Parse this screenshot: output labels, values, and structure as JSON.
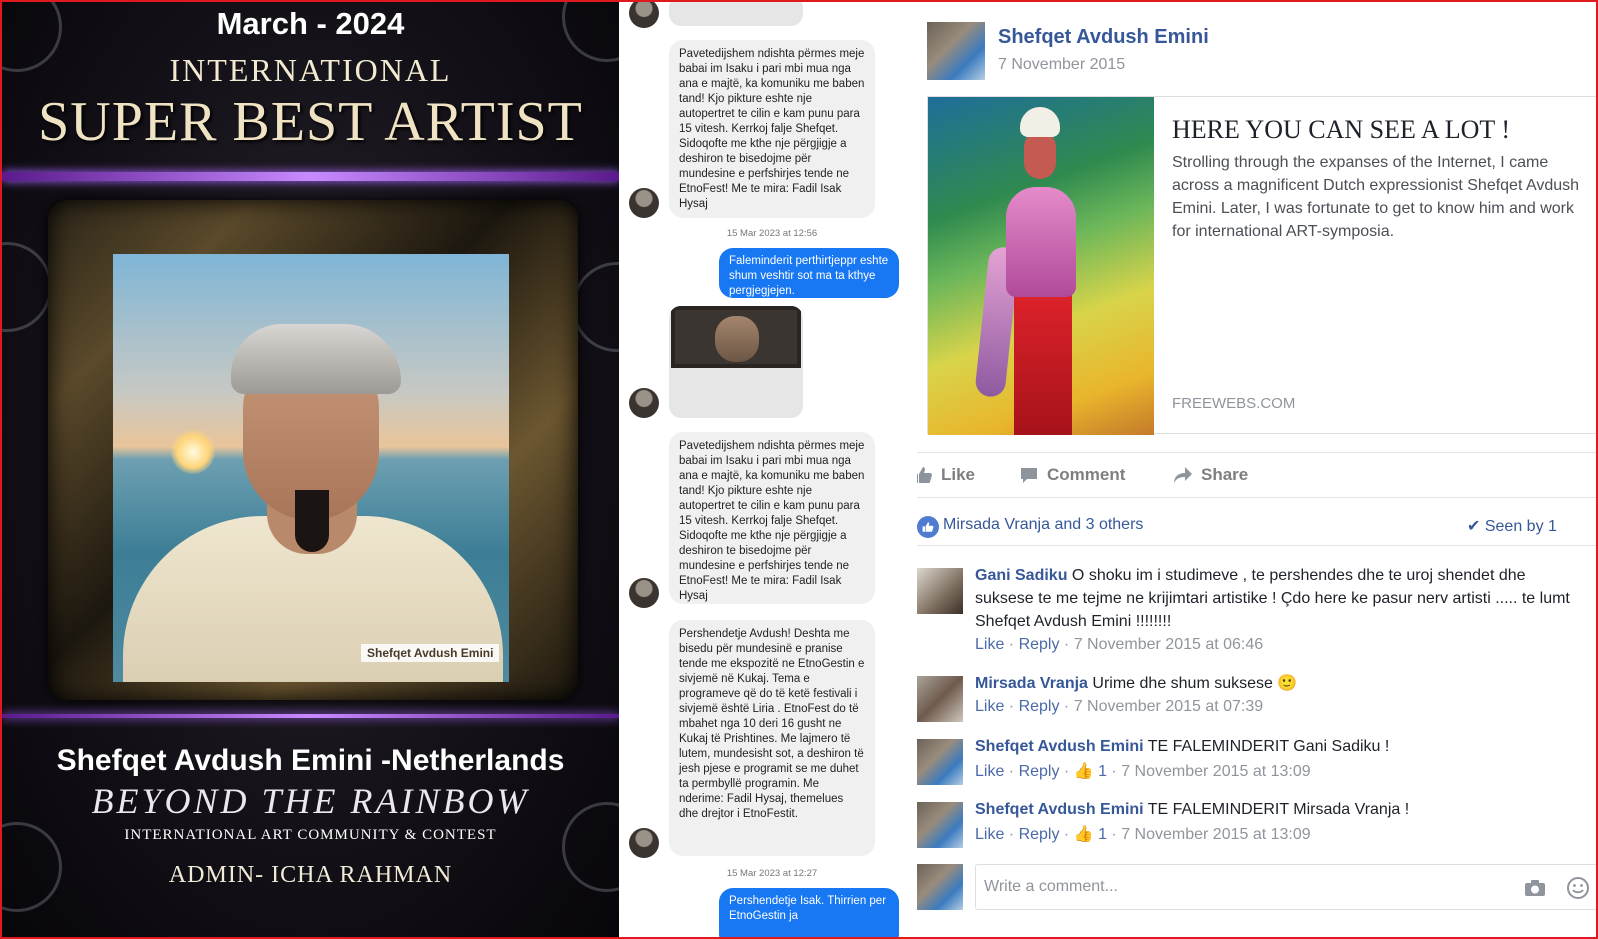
{
  "poster": {
    "date": "March - 2024",
    "subtitle": "INTERNATIONAL",
    "title": "SUPER BEST ARTIST",
    "photo_caption": "Shefqet Avdush Emini",
    "name": "Shefqet Avdush Emini -Netherlands",
    "tagline": "BEYOND THE RAINBOW",
    "community": "INTERNATIONAL ART COMMUNITY & CONTEST",
    "admin": "ADMIN- ICHA RAHMAN"
  },
  "chat": {
    "msg1": "Pavetedijshem ndishta përmes meje babai im Isaku i pari mbi mua nga ana e majtë, ka komuniku me baben tand! Kjo pikture eshte nje autopertret te cilin e kam punu para 15 vitesh. Kerrkoj falje Shefqet. Sidoqofte me kthe nje përgjigje a deshiron te bisedojme për mundesine e perfshirjes tende ne EtnoFest! Me te mira: Fadil Isak Hysaj",
    "ts1": "15 Mar 2023 at 12:56",
    "reply1": "Faleminderit perthirtjeppr eshte shum veshtir sot ma ta kthye pergjegjejen.",
    "msg2": "Pavetedijshem ndishta përmes meje babai im Isaku i pari mbi mua nga ana e majtë, ka komuniku me baben tand! Kjo pikture eshte nje autopertret te cilin e kam punu para 15 vitesh. Kerrkoj falje Shefqet. Sidoqofte me kthe nje përgjigje a deshiron te bisedojme për mundesine e perfshirjes tende ne EtnoFest! Me te mira: Fadil Isak Hysaj",
    "msg3": "Pershendetje Avdush!  Deshta me bisedu për mundesinë e pranise tende me ekspozitë ne EtnoGestin e sivjemë në Kukaj. Tema e programeve që do të ketë festivali i sivjemë është Liria . EtnoFest  do të mbahet nga 10  deri 16 gusht ne Kukaj të Prishtines. Me lajmero të lutem, mundesisht sot, a deshiron të jesh pjese e programit se me duhet ta permbyllë programin. Me nderime: Fadil Hysaj, themelues dhe drejtor i EtnoFestit.",
    "ts2": "15 Mar 2023 at 12:27",
    "reply2": "Pershendetje Isak. Thirrien per EtnoGestin ja"
  },
  "post": {
    "author": "Shefqet Avdush Emini",
    "date": "7 November 2015",
    "link_title": "HERE YOU CAN SEE A LOT !",
    "link_text": "Strolling through the expanses of the Internet, I came across a magnificent Dutch expressionist Shefqet Avdush Emini. Later, I was fortunate to get to know him and work for international ART-symposia.",
    "link_source": "FREEWEBS.COM",
    "actions": {
      "like": "Like",
      "comment": "Comment",
      "share": "Share"
    },
    "likes_text": "Mirsada Vranja and 3 others",
    "seen_text": "Seen by 1"
  },
  "comments": [
    {
      "name": "Gani Sadiku",
      "text": "O shoku im i studimeve , te pershendes dhe te uroj shendet dhe suksese te me tejme ne krijimtari artistike ! Çdo here ke pasur nerv artisti ..... te lumt Shefqet Avdush Emini !!!!!!!!",
      "like": "Like",
      "reply": "Reply",
      "likes": "",
      "time": "7 November 2015 at 06:46"
    },
    {
      "name": "Mirsada Vranja",
      "text": "Urime dhe shum suksese 🙂",
      "like": "Like",
      "reply": "Reply",
      "likes": "",
      "time": "7 November 2015 at 07:39"
    },
    {
      "name": "Shefqet Avdush Emini",
      "text": "TE FALEMINDERIT Gani Sadiku !",
      "like": "Like",
      "reply": "Reply",
      "likes": "1",
      "time": "7 November 2015 at 13:09"
    },
    {
      "name": "Shefqet Avdush Emini",
      "text": "TE FALEMINDERIT Mirsada Vranja !",
      "like": "Like",
      "reply": "Reply",
      "likes": "1",
      "time": "7 November 2015 at 13:09"
    }
  ],
  "comment_box": {
    "placeholder": "Write a comment..."
  },
  "colors": {
    "fb_link": "#365899",
    "messenger_blue": "#1877f2",
    "frame_red": "#e0191f"
  }
}
